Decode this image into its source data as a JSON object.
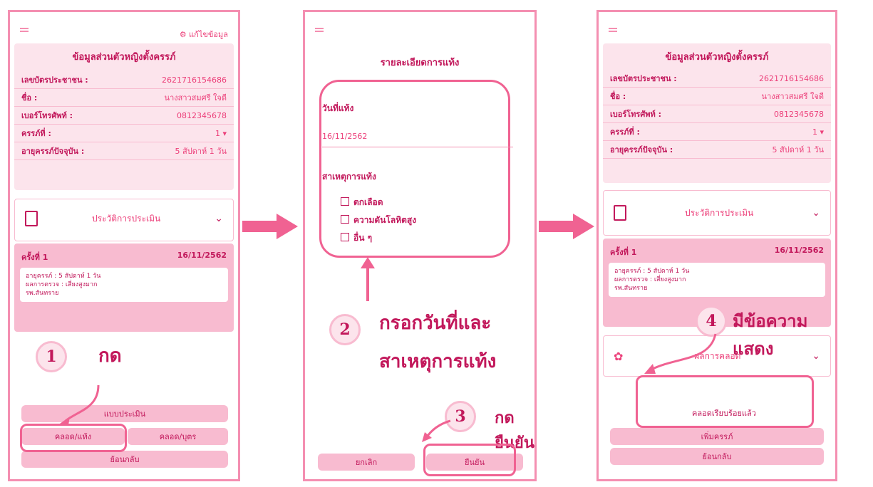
{
  "panel1": {
    "edit_label": "⚙ แก้ไขข้อมูล",
    "card_title": "ข้อมูลส่วนตัวหญิงตั้งครรภ์",
    "fields": [
      {
        "label": "เลขบัตรประชาชน :",
        "value": "2621716154686"
      },
      {
        "label": "ชื่อ :",
        "value": "นางสาวสมศรี ใจดี"
      },
      {
        "label": "เบอร์โทรศัพท์ :",
        "value": "0812345678"
      },
      {
        "label": "ครรภ์ที่ :",
        "value": "1"
      },
      {
        "label": "อายุครรภ์ปัจจุบัน :",
        "value": "5 สัปดาห์ 1 วัน"
      }
    ],
    "history_label": "ประวัติการประเมิน",
    "visit": {
      "title": "ครั้งที่ 1",
      "date": "16/11/2562",
      "line1": "อายุครรภ์ : 5 สัปดาห์ 1 วัน",
      "line2": "ผลการตรวจ : เสี่ยงสูงมาก",
      "line3": "รพ.สันทราย"
    },
    "btn_assess": "แบบประเมิน",
    "btn_birth_abort": "คลอด/แท้ง",
    "btn_birth_child": "คลอด/บุตร",
    "btn_back": "ย้อนกลับ",
    "step_num": "1",
    "step_text": "กด"
  },
  "panel2": {
    "title": "รายละเอียดการแท้ง",
    "date_label": "วันที่แท้ง",
    "date_value": "16/11/2562",
    "cause_label": "สาเหตุการแท้ง",
    "causes": [
      "ตกเลือด",
      "ความดันโลหิตสูง",
      "อื่น ๆ"
    ],
    "btn_cancel": "ยกเลิก",
    "btn_confirm": "ยืนยัน",
    "step2_num": "2",
    "step2_text1": "กรอกวันที่และ",
    "step2_text2": "สาเหตุการแท้ง",
    "step3_num": "3",
    "step3_text": "กด ยืนยัน"
  },
  "panel3": {
    "card_title": "ข้อมูลส่วนตัวหญิงตั้งครรภ์",
    "fields": [
      {
        "label": "เลขบัตรประชาชน :",
        "value": "2621716154686"
      },
      {
        "label": "ชื่อ :",
        "value": "นางสาวสมศรี ใจดี"
      },
      {
        "label": "เบอร์โทรศัพท์ :",
        "value": "0812345678"
      },
      {
        "label": "ครรภ์ที่ :",
        "value": "1"
      },
      {
        "label": "อายุครรภ์ปัจจุบัน :",
        "value": "5 สัปดาห์ 1 วัน"
      }
    ],
    "history_label": "ประวัติการประเมิน",
    "visit": {
      "title": "ครั้งที่ 1",
      "date": "16/11/2562",
      "line1": "อายุครรภ์ : 5 สัปดาห์ 1 วัน",
      "line2": "ผลการตรวจ : เสี่ยงสูงมาก",
      "line3": "รพ.สันทราย"
    },
    "delivery_label": "ผลการคลอด",
    "message": "คลอดเรียบร้อยแล้ว",
    "btn_add": "เพิ่มครรภ์",
    "btn_back": "ย้อนกลับ",
    "step_num": "4",
    "step_text": "มีข้อความแสดง"
  },
  "colors": {
    "accent": "#f06292",
    "light": "#fce4ec",
    "dark": "#c2185b"
  }
}
